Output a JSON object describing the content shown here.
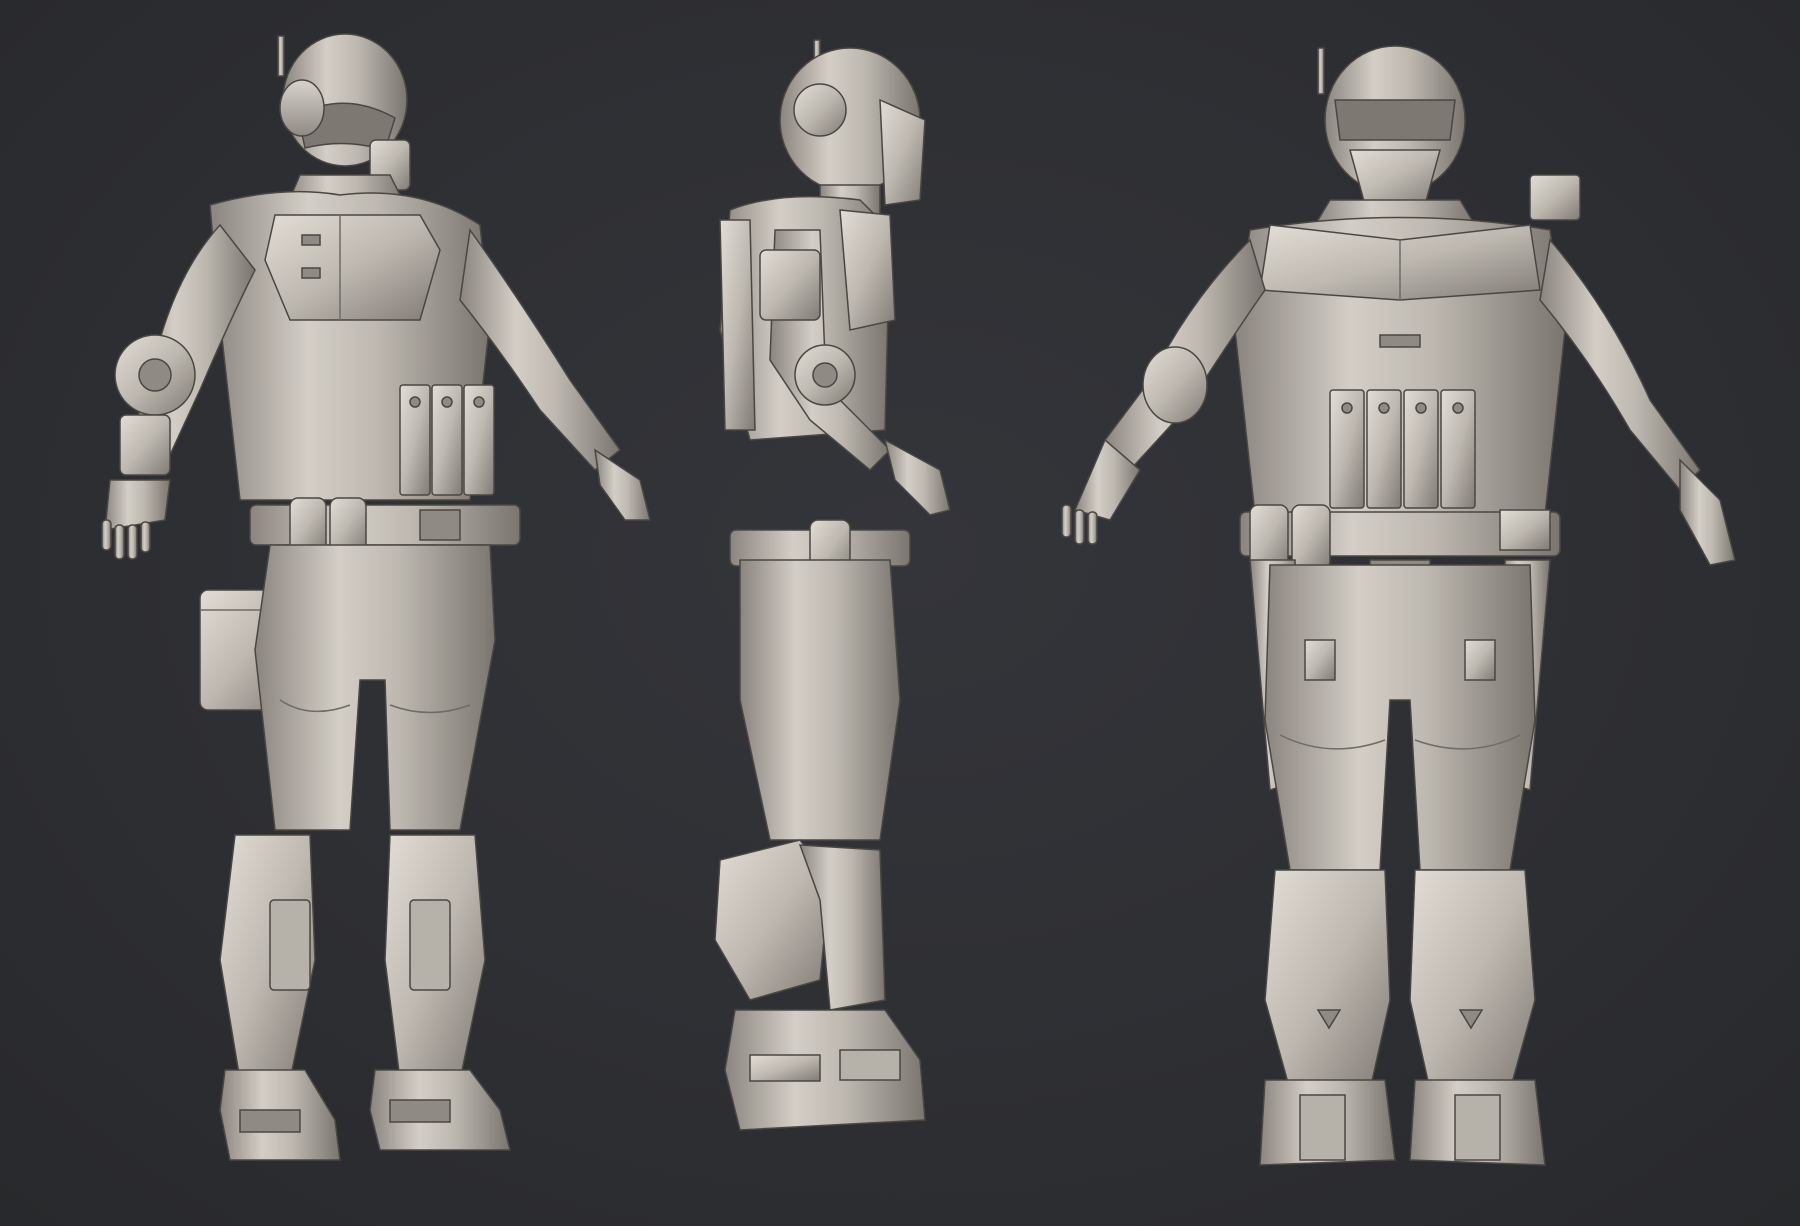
{
  "scene": {
    "background": "#2d2e31",
    "material_light": "#d6d1c9",
    "material_mid": "#a9a49c",
    "material_dark": "#6f6b65",
    "views": [
      {
        "id": "three-quarter"
      },
      {
        "id": "side"
      },
      {
        "id": "front"
      }
    ]
  }
}
